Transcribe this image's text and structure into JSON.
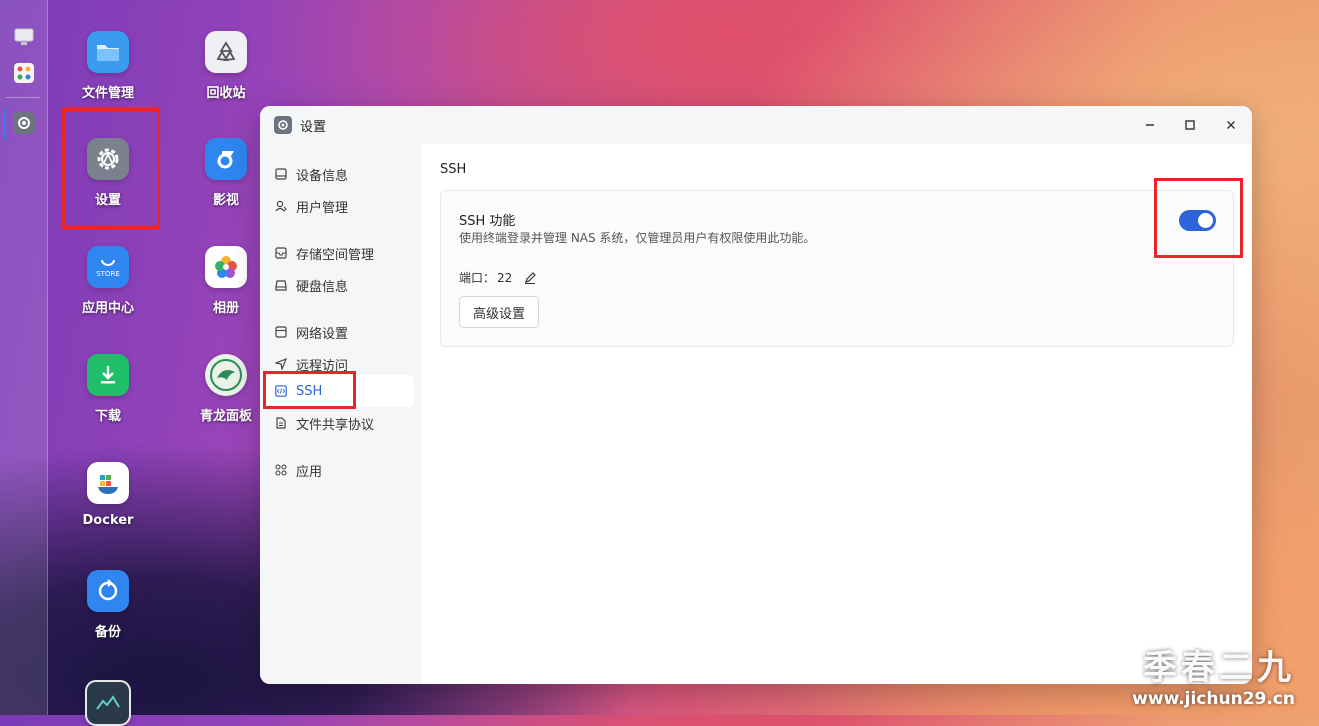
{
  "desktop": {
    "icons": [
      {
        "label": "文件管理",
        "icon": "folder-icon"
      },
      {
        "label": "回收站",
        "icon": "recycle-bin-icon"
      },
      {
        "label": "设置",
        "icon": "settings-gear-icon"
      },
      {
        "label": "影视",
        "icon": "video-icon"
      },
      {
        "label": "应用中心",
        "icon": "store-icon"
      },
      {
        "label": "相册",
        "icon": "photos-icon"
      },
      {
        "label": "下载",
        "icon": "download-icon"
      },
      {
        "label": "青龙面板",
        "icon": "qinglong-icon"
      },
      {
        "label": "Docker",
        "icon": "docker-icon"
      },
      {
        "label": "备份",
        "icon": "backup-icon"
      }
    ]
  },
  "window": {
    "title": "设置",
    "nav": [
      {
        "label": "设备信息",
        "icon": "device-icon"
      },
      {
        "label": "用户管理",
        "icon": "user-icon"
      },
      {
        "label": "存储空间管理",
        "icon": "storage-icon"
      },
      {
        "label": "硬盘信息",
        "icon": "disk-icon"
      },
      {
        "label": "网络设置",
        "icon": "network-icon"
      },
      {
        "label": "远程访问",
        "icon": "remote-icon"
      },
      {
        "label": "SSH",
        "icon": "code-icon",
        "active": true
      },
      {
        "label": "文件共享协议",
        "icon": "file-share-icon"
      },
      {
        "label": "应用",
        "icon": "apps-icon"
      }
    ],
    "section_title": "SSH",
    "ssh": {
      "heading": "SSH 功能",
      "description": "使用终端登录并管理 NAS 系统，仅管理员用户有权限使用此功能。",
      "port_label": "端口：",
      "port_value": "22",
      "advanced_button": "高级设置",
      "enabled": true
    }
  },
  "watermark": {
    "line1": "季春二九",
    "line2": "www.jichun29.cn"
  },
  "colors": {
    "accent": "#2f63d8",
    "highlight_box": "#e8252a"
  }
}
